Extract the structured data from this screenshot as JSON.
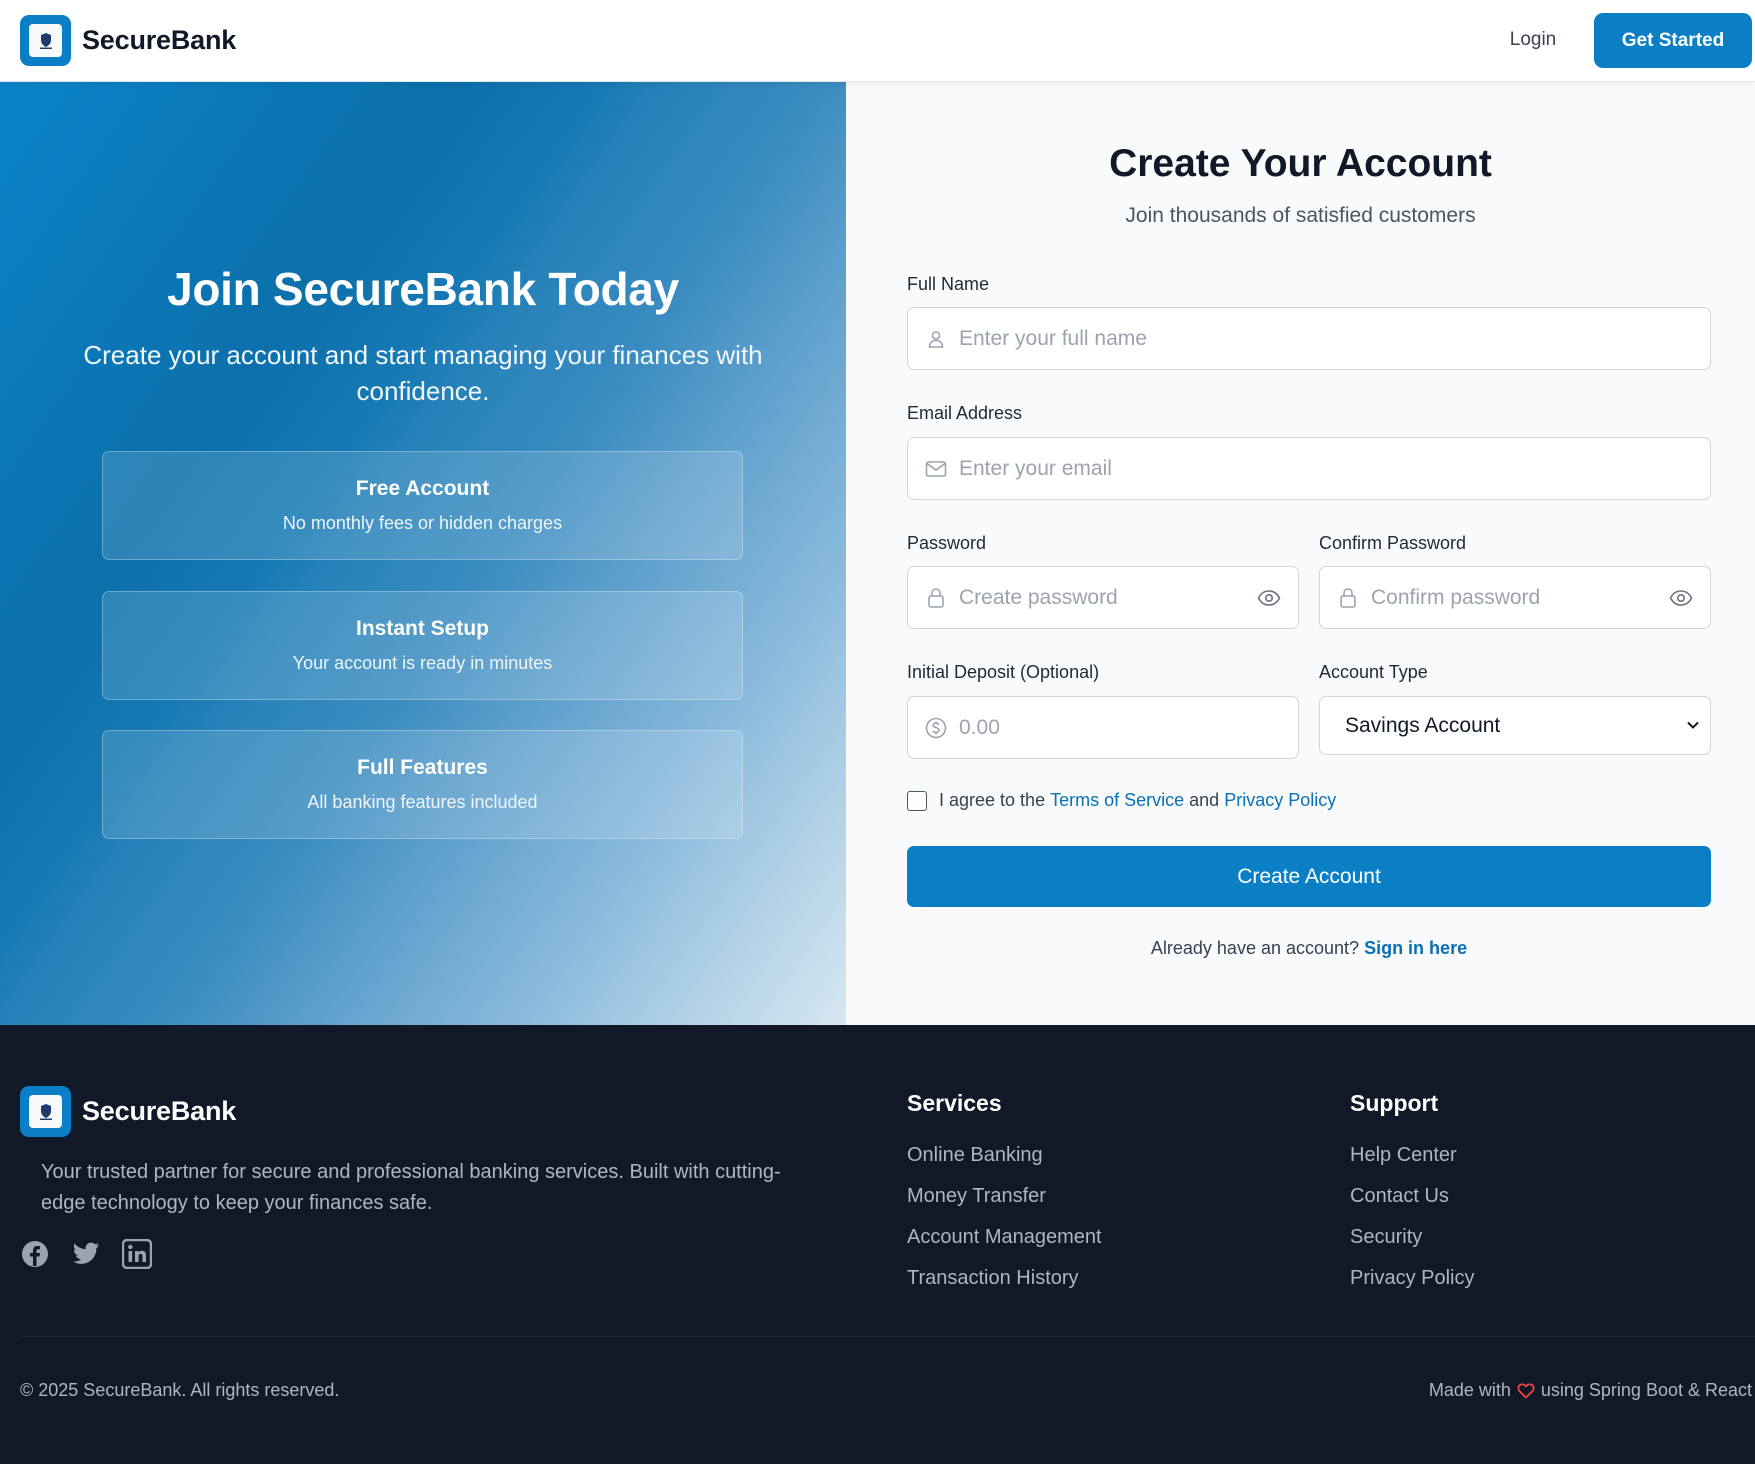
{
  "header": {
    "brand": "SecureBank",
    "login_label": "Login",
    "cta_label": "Get Started"
  },
  "hero": {
    "title": "Join SecureBank Today",
    "subtitle": "Create your account and start managing your finances with confidence.",
    "features": [
      {
        "title": "Free Account",
        "description": "No monthly fees or hidden charges"
      },
      {
        "title": "Instant Setup",
        "description": "Your account is ready in minutes"
      },
      {
        "title": "Full Features",
        "description": "All banking features included"
      }
    ]
  },
  "form": {
    "title": "Create Your Account",
    "subtitle": "Join thousands of satisfied customers",
    "full_name": {
      "label": "Full Name",
      "placeholder": "Enter your full name",
      "icon": "user-icon"
    },
    "email": {
      "label": "Email Address",
      "placeholder": "Enter your email",
      "icon": "mail-icon"
    },
    "password": {
      "label": "Password",
      "placeholder": "Create password",
      "icon": "lock-icon"
    },
    "confirm_password": {
      "label": "Confirm Password",
      "placeholder": "Confirm password",
      "icon": "lock-icon"
    },
    "deposit": {
      "label": "Initial Deposit (Optional)",
      "placeholder": "0.00",
      "icon": "dollar-circle-icon"
    },
    "account_type": {
      "label": "Account Type",
      "selected": "Savings Account"
    },
    "agree": {
      "prefix": "I agree to the",
      "terms": "Terms of Service",
      "and": "and",
      "privacy": "Privacy Policy",
      "checked": false
    },
    "submit_label": "Create Account",
    "signin_prompt": "Already have an account?",
    "signin_link": "Sign in here"
  },
  "footer": {
    "brand": "SecureBank",
    "description": "Your trusted partner for secure and professional banking services. Built with cutting-edge technology to keep your finances safe.",
    "socials": [
      "facebook-icon",
      "twitter-icon",
      "linkedin-icon"
    ],
    "services": {
      "title": "Services",
      "links": [
        "Online Banking",
        "Money Transfer",
        "Account Management",
        "Transaction History"
      ]
    },
    "support": {
      "title": "Support",
      "links": [
        "Help Center",
        "Contact Us",
        "Security",
        "Privacy Policy"
      ]
    },
    "copyright": "© 2025 SecureBank. All rights reserved.",
    "made_with_prefix": "Made with",
    "made_with_suffix": "using Spring Boot & React"
  },
  "colors": {
    "primary": "#0a7fc6",
    "link": "#0a70b5",
    "footer_bg": "#111827",
    "heart": "#ef4444"
  }
}
